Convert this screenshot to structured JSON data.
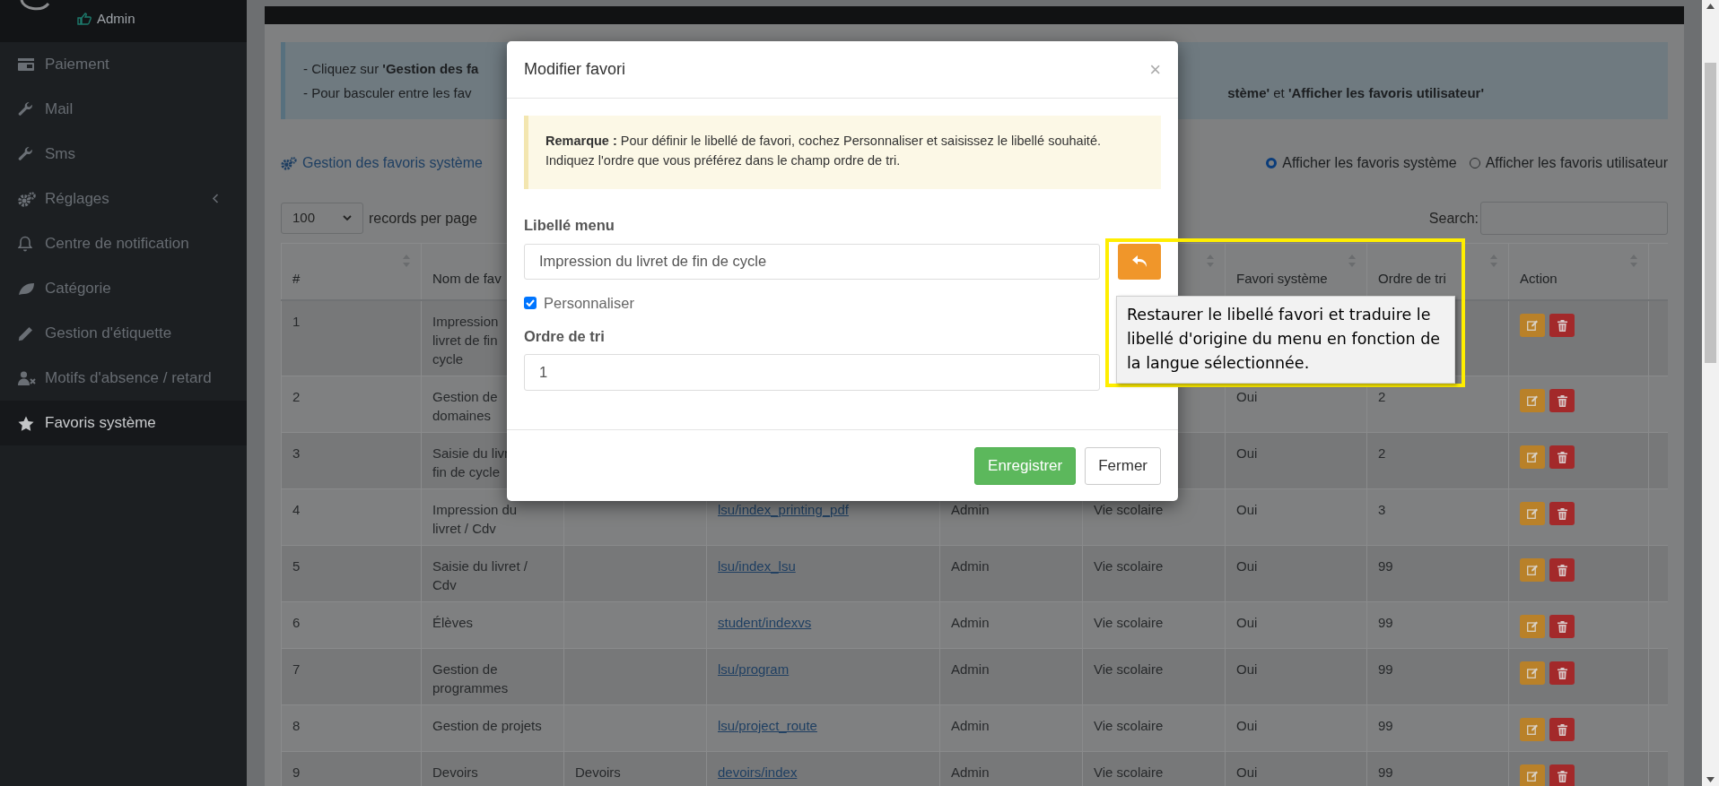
{
  "sidebar": {
    "user": "Admin",
    "items": [
      {
        "label": "Paiement",
        "selected": false,
        "has_submenu": false
      },
      {
        "label": "Mail",
        "selected": false,
        "has_submenu": false
      },
      {
        "label": "Sms",
        "selected": false,
        "has_submenu": false
      },
      {
        "label": "Réglages",
        "selected": false,
        "has_submenu": true
      },
      {
        "label": "Centre de notification",
        "selected": false,
        "has_submenu": false
      },
      {
        "label": "Catégorie",
        "selected": false,
        "has_submenu": false
      },
      {
        "label": "Gestion d'étiquette",
        "selected": false,
        "has_submenu": false
      },
      {
        "label": "Motifs d'absence / retard",
        "selected": false,
        "has_submenu": false
      },
      {
        "label": "Favoris système",
        "selected": true,
        "has_submenu": false
      }
    ]
  },
  "info": {
    "line_1": "- Cliquez sur **'Gestion des fa**",
    "line_2_start": "- Pour basculer entre les fav",
    "line_2_end": "**stème'** et **'Afficher les favoris utilisateur'**"
  },
  "section_link": "Gestion des favoris système",
  "view_options": [
    {
      "label": "Afficher les favoris système",
      "selected": true
    },
    {
      "label": "Afficher les favoris utilisateur",
      "selected": false
    }
  ],
  "page_size": {
    "value": "100",
    "label": "records per page"
  },
  "search": {
    "label": "Search:"
  },
  "table": {
    "columns": {
      "number": "#",
      "name": "Nom de fav",
      "system_favorite": "Favori système",
      "sort_order": "Ordre de tri",
      "action": "Action"
    },
    "rows": [
      {
        "number": "1",
        "name_lines": [
          "Impression",
          "livret de fin",
          "cycle"
        ]
      },
      {
        "number": "2",
        "name_lines": [
          "Gestion de",
          "domaines"
        ],
        "system_favorite": "Oui",
        "sort_order": "2"
      },
      {
        "number": "3",
        "name_lines": [
          "Saisie du livr",
          "fin de cycle"
        ],
        "system_favorite": "Oui",
        "sort_order": "2"
      },
      {
        "number": "4",
        "name_lines": [
          "Impression du",
          "livret / Cdv"
        ],
        "link": "lsu/index_printing_pdf",
        "column_5": "Admin",
        "column_6": "Vie scolaire",
        "system_favorite": "Oui",
        "sort_order": "3"
      },
      {
        "number": "5",
        "name_lines": [
          "Saisie du livret /",
          "Cdv"
        ],
        "link": "lsu/index_lsu",
        "column_5": "Admin",
        "column_6": "Vie scolaire",
        "system_favorite": "Oui",
        "sort_order": "99"
      },
      {
        "number": "6",
        "name_lines": [
          "Élèves"
        ],
        "link": "student/indexvs",
        "column_5": "Admin",
        "column_6": "Vie scolaire",
        "system_favorite": "Oui",
        "sort_order": "99"
      },
      {
        "number": "7",
        "name_lines": [
          "Gestion de",
          "programmes"
        ],
        "link": "lsu/program",
        "column_5": "Admin",
        "column_6": "Vie scolaire",
        "system_favorite": "Oui",
        "sort_order": "99"
      },
      {
        "number": "8",
        "name_lines": [
          "Gestion de projets"
        ],
        "link": "lsu/project_route",
        "column_5": "Admin",
        "column_6": "Vie scolaire",
        "system_favorite": "Oui",
        "sort_order": "99"
      },
      {
        "number": "9",
        "name_lines": [
          "Devoirs"
        ],
        "column_3": "Devoirs",
        "link": "devoirs/index",
        "column_5": "Admin",
        "column_6": "Vie scolaire",
        "system_favorite": "Oui",
        "sort_order": "99"
      }
    ]
  },
  "modal": {
    "title": "Modifier favori",
    "close": "×",
    "note": "**Remarque :** Pour définir le libellé de favori, cochez Personnaliser et saisissez le libellé souhaité. Indiquez l'ordre que vous préférez dans le champ ordre de tri.",
    "label_field": {
      "label": "Libellé menu",
      "value": "Impression du livret de fin de cycle"
    },
    "customize": {
      "label": "Personnaliser",
      "checked": true
    },
    "sort_field": {
      "label": "Ordre de tri",
      "value": "1"
    },
    "buttons": [
      {
        "label": "Enregistrer",
        "kind": "primary"
      },
      {
        "label": "Fermer",
        "kind": "default"
      }
    ]
  },
  "tooltip": {
    "text": "Restaurer le libellé favori et traduire le libellé d'origine du menu en fonction de la langue sélectionnée."
  }
}
